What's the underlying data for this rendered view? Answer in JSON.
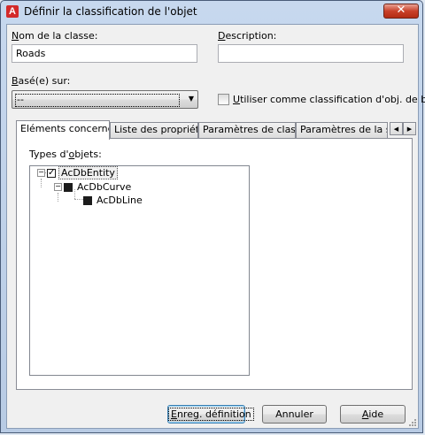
{
  "window": {
    "title": "Définir la classification de l'objet",
    "app_icon_letter": "A",
    "close_glyph": "✕",
    "app_icon": "autocad-icon"
  },
  "form": {
    "name_label_accel": "N",
    "name_label_rest": "om de la classe:",
    "name_value": "Roads",
    "description_label_accel": "D",
    "description_label_rest": "escription:",
    "description_value": "",
    "based_on_label_accel": "B",
    "based_on_label_rest": "asé(e) sur:",
    "based_on_value": "--",
    "use_as_base_accel": "U",
    "use_as_base_rest": "tiliser comme classification d'obj. de base",
    "use_as_base_checked": false
  },
  "tabs": [
    {
      "label": "Eléments concernés",
      "active": true
    },
    {
      "label": "Liste des propriétés",
      "active": false
    },
    {
      "label": "Paramètres de classe",
      "active": false
    },
    {
      "label": "Paramètres de la so",
      "active": false
    }
  ],
  "tab_scroll": {
    "left": "◀",
    "right": "▶"
  },
  "panel": {
    "object_types_label_pre": "Types d'",
    "object_types_label_accel": "o",
    "object_types_label_post": "bjets:",
    "tree": [
      {
        "label": "AcDbEntity",
        "level": 0,
        "check": "checked",
        "expander": "−",
        "selected": true
      },
      {
        "label": "AcDbCurve",
        "level": 1,
        "check": "partial",
        "expander": "−",
        "selected": false
      },
      {
        "label": "AcDbLine",
        "level": 2,
        "check": "partial",
        "expander": "",
        "selected": false
      }
    ]
  },
  "buttons": {
    "save_accel": "E",
    "save_rest": "nreg. définition",
    "cancel": "Annuler",
    "help_accel": "A",
    "help_rest": "ide"
  }
}
